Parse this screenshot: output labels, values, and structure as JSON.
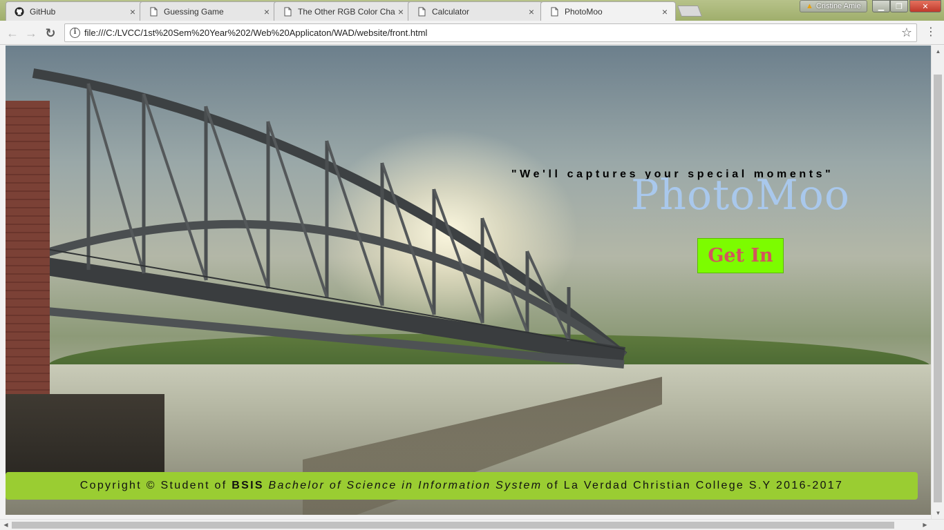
{
  "tabs": [
    {
      "title": "GitHub",
      "icon": "github-icon",
      "close": "×"
    },
    {
      "title": "Guessing Game",
      "icon": "page-icon",
      "close": "×"
    },
    {
      "title": "The Other RGB Color Cha",
      "icon": "page-icon",
      "close": "×"
    },
    {
      "title": "Calculator",
      "icon": "page-icon",
      "close": "×"
    },
    {
      "title": "PhotoMoo",
      "icon": "page-icon",
      "close": "×",
      "active": true
    }
  ],
  "profile": {
    "name": "Cristine Amie",
    "icon": "warning-icon"
  },
  "window_controls": {
    "minimize": "▁",
    "maximize": "❐",
    "close": "✕"
  },
  "toolbar": {
    "back": "←",
    "forward": "→",
    "reload": "↻",
    "url": "file:///C:/LVCC/1st%20Sem%20Year%202/Web%20Applicaton/WAD/website/front.html",
    "info": "i",
    "star": "☆",
    "menu": "⋮"
  },
  "hero": {
    "tagline": "\"We'll captures your special moments\"",
    "brand": "PhotoMoo",
    "cta": "Get In"
  },
  "footer": {
    "prefix": "Copyright © Student of ",
    "bold": "BSIS",
    "italic": "Bachelor of Science in Information System",
    "suffix": " of La Verdad Christian College S.Y 2016-2017"
  },
  "colors": {
    "brand": "#a9c8ec",
    "cta_bg": "#7cfc00",
    "cta_text": "#d3555d",
    "footer_bg": "#9acd32"
  }
}
